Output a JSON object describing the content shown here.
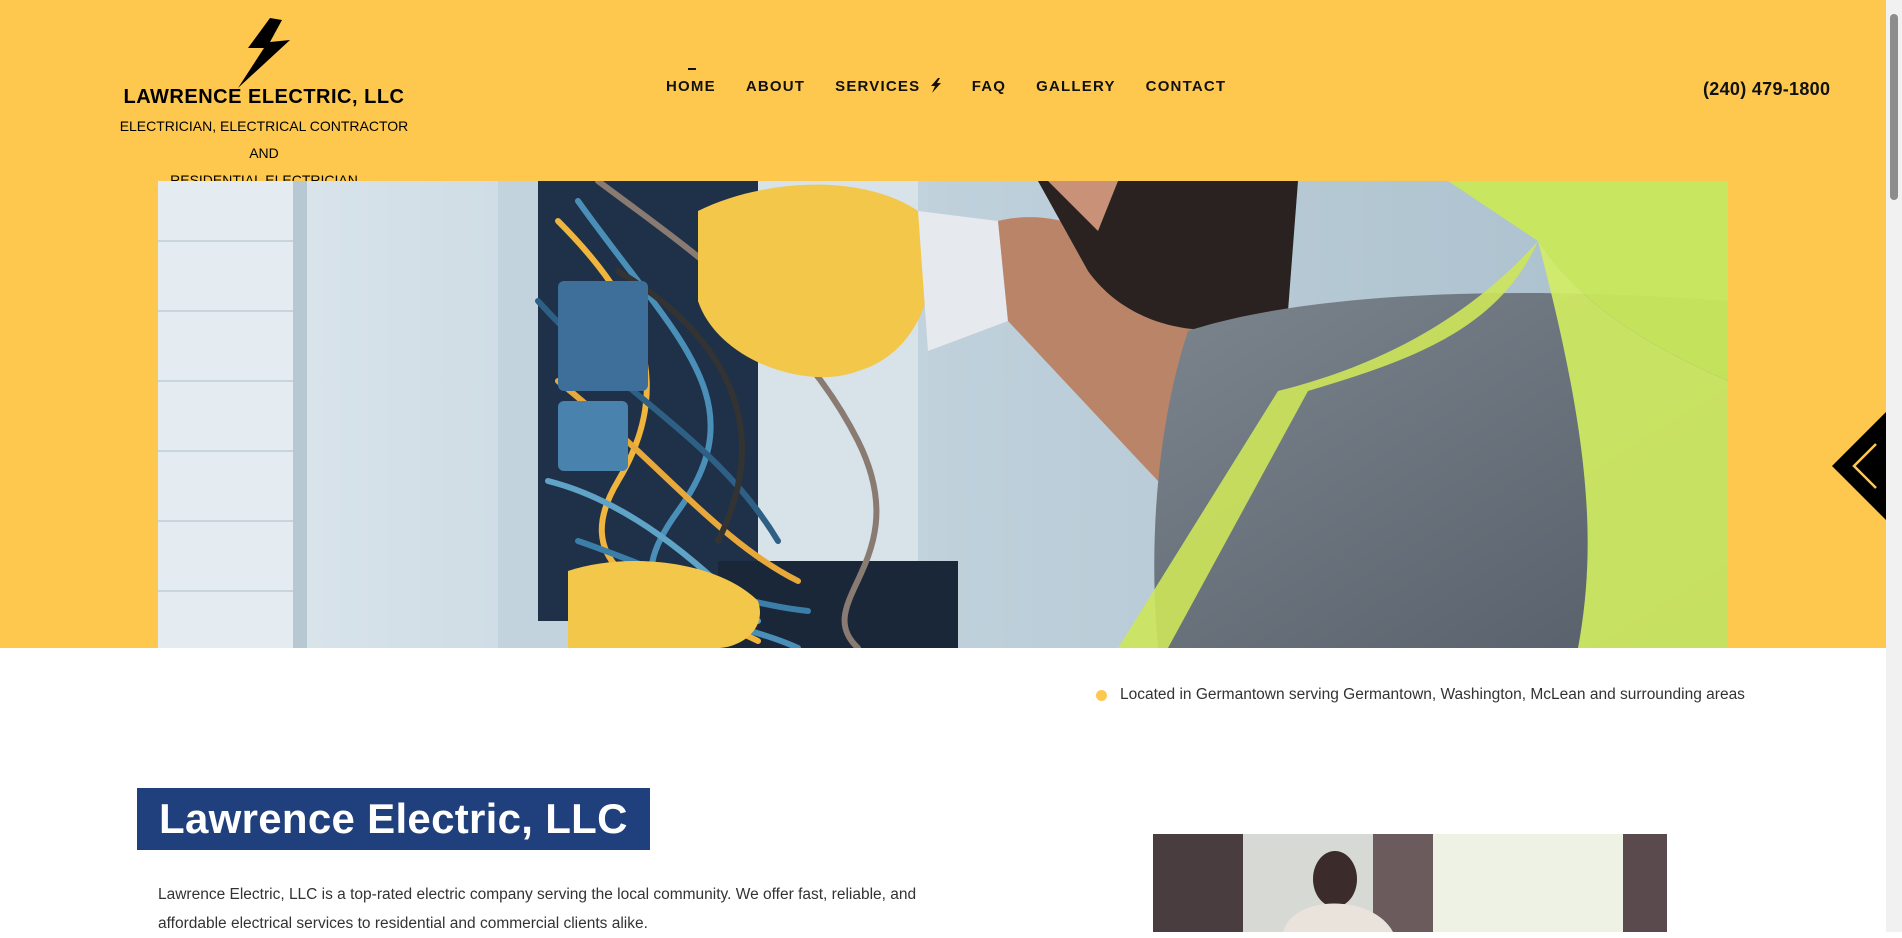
{
  "brand": {
    "name": "LAWRENCE ELECTRIC, LLC",
    "tagline_line1": "ELECTRICIAN, ELECTRICAL CONTRACTOR AND",
    "tagline_line2": "RESIDENTIAL ELECTRICIAN",
    "logo_icon": "lightning-bolt-icon"
  },
  "nav": {
    "items": [
      {
        "label": "HOME",
        "active": true
      },
      {
        "label": "ABOUT"
      },
      {
        "label": "SERVICES"
      },
      {
        "label": "FAQ"
      },
      {
        "label": "GALLERY"
      },
      {
        "label": "CONTACT"
      }
    ]
  },
  "header": {
    "phone": "(240) 479-1800"
  },
  "location": {
    "text": "Located in Germantown serving Germantown, Washington, McLean and surrounding areas"
  },
  "about": {
    "title": "Lawrence Electric, LLC",
    "text": "Lawrence Electric, LLC is a top-rated electric company serving the local community. We offer fast, reliable, and affordable electrical services to residential and commercial clients alike."
  },
  "colors": {
    "brand_yellow": "#fec84e",
    "title_blue": "#1f3f7d",
    "text": "#333333"
  }
}
